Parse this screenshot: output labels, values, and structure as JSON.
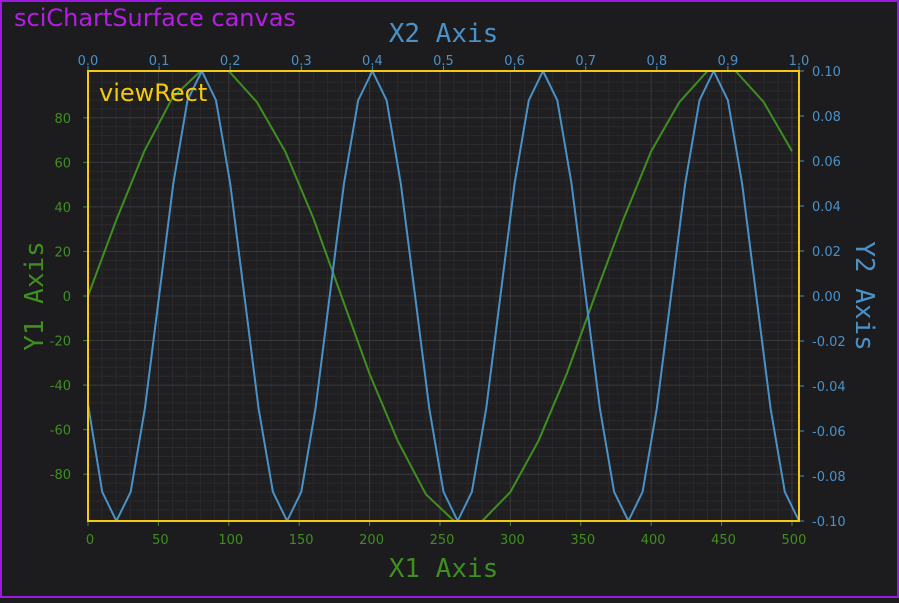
{
  "labels": {
    "canvas": "sciChartSurface canvas",
    "view_rect": "viewRect"
  },
  "colors": {
    "background": "#1c1c1e",
    "canvas_border": "#9b19e0",
    "canvas_label": "#b71ce6",
    "view_rect_border": "#f4c90f",
    "view_rect_label": "#f4c90f",
    "series1": "#3f8f1f",
    "series2": "#4a91c8",
    "y1_axis": "#3f8f1f",
    "y2_axis": "#4a91c8",
    "x1_axis": "#3f8f1f",
    "x2_axis": "#4a91c8",
    "grid_major": "#3a3a3c",
    "grid_minor": "#2a2a2c"
  },
  "chart_data": {
    "type": "line",
    "grid": true,
    "axes": {
      "x1": {
        "title": "X1 Axis",
        "position": "bottom",
        "range": [
          0,
          505
        ],
        "ticks": [
          "0",
          "50",
          "100",
          "150",
          "200",
          "250",
          "300",
          "350",
          "400",
          "450",
          "500"
        ]
      },
      "x2": {
        "title": "X2 Axis",
        "position": "top",
        "range": [
          0,
          1.0
        ],
        "ticks": [
          "0.0",
          "0.1",
          "0.2",
          "0.3",
          "0.4",
          "0.5",
          "0.6",
          "0.7",
          "0.8",
          "0.9",
          "1.0"
        ]
      },
      "y1": {
        "title": "Y1 Axis",
        "position": "left",
        "range": [
          -101,
          101
        ],
        "ticks": [
          "80",
          "60",
          "40",
          "20",
          "0",
          "-20",
          "-40",
          "-60",
          "-80"
        ]
      },
      "y2": {
        "title": "Y2 Axis",
        "position": "right",
        "range": [
          -0.1,
          0.1
        ],
        "ticks": [
          "0.10",
          "0.08",
          "0.06",
          "0.04",
          "0.02",
          "0.00",
          "-0.02",
          "-0.04",
          "-0.06",
          "-0.08",
          "-0.10"
        ]
      }
    },
    "series": [
      {
        "x_axis": "x1",
        "y_axis": "y1",
        "x": [
          0,
          20,
          40,
          60,
          80,
          100,
          120,
          140,
          160,
          180,
          200,
          220,
          240,
          260,
          280,
          300,
          320,
          340,
          360,
          380,
          400,
          420,
          440,
          460,
          480,
          500
        ],
        "y": [
          0,
          34,
          65,
          89,
          101,
          101,
          87,
          65,
          35,
          0,
          -35,
          -65,
          -89,
          -101,
          -101,
          -88,
          -65,
          -35,
          0,
          34,
          65,
          87,
          101,
          101,
          87,
          65
        ]
      },
      {
        "x_axis": "x2",
        "y_axis": "y2",
        "x": [
          0,
          0.02,
          0.04,
          0.06,
          0.08,
          0.1,
          0.12,
          0.14,
          0.16,
          0.18,
          0.2,
          0.22,
          0.24,
          0.26,
          0.28,
          0.3,
          0.32,
          0.34,
          0.36,
          0.38,
          0.4,
          0.42,
          0.44,
          0.46,
          0.48,
          0.5,
          0.52,
          0.54,
          0.56,
          0.58,
          0.6,
          0.62,
          0.64,
          0.66,
          0.68,
          0.7,
          0.72,
          0.74,
          0.76,
          0.78,
          0.8,
          0.82,
          0.84,
          0.86,
          0.88,
          0.9,
          0.92,
          0.94,
          0.96,
          0.98,
          1.0
        ],
        "y": [
          -0.048,
          -0.087,
          -0.1,
          -0.087,
          -0.05,
          0.0,
          0.05,
          0.087,
          0.1,
          0.087,
          0.05,
          0.0,
          -0.05,
          -0.087,
          -0.1,
          -0.087,
          -0.05,
          0.0,
          0.05,
          0.087,
          0.1,
          0.087,
          0.05,
          0.0,
          -0.05,
          -0.087,
          -0.1,
          -0.087,
          -0.05,
          0.0,
          0.05,
          0.087,
          0.1,
          0.087,
          0.05,
          0.0,
          -0.05,
          -0.087,
          -0.1,
          -0.087,
          -0.05,
          0.0,
          0.05,
          0.087,
          0.1,
          0.087,
          0.05,
          0.0,
          -0.05,
          -0.087,
          -0.1
        ]
      }
    ]
  }
}
